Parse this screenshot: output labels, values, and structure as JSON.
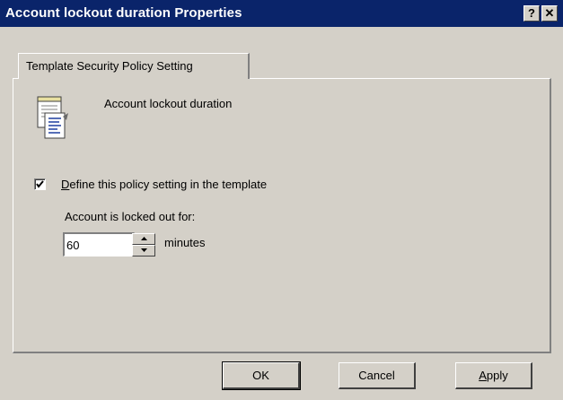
{
  "window": {
    "title": "Account lockout duration Properties",
    "help_label": "?",
    "close_label": "✕"
  },
  "tab": {
    "label": "Template Security Policy Setting"
  },
  "policy": {
    "name": "Account lockout duration",
    "icon": "policy-document-icon"
  },
  "define_setting": {
    "checked": true,
    "label_accel": "D",
    "label_rest": "efine this policy setting in the template"
  },
  "lockout": {
    "label": "Account is locked out for:",
    "value": "60",
    "units": "minutes"
  },
  "buttons": {
    "ok": "OK",
    "cancel": "Cancel",
    "apply_accel": "A",
    "apply_rest": "pply"
  },
  "colors": {
    "titlebar": "#0a246a",
    "face": "#d4d0c8"
  }
}
